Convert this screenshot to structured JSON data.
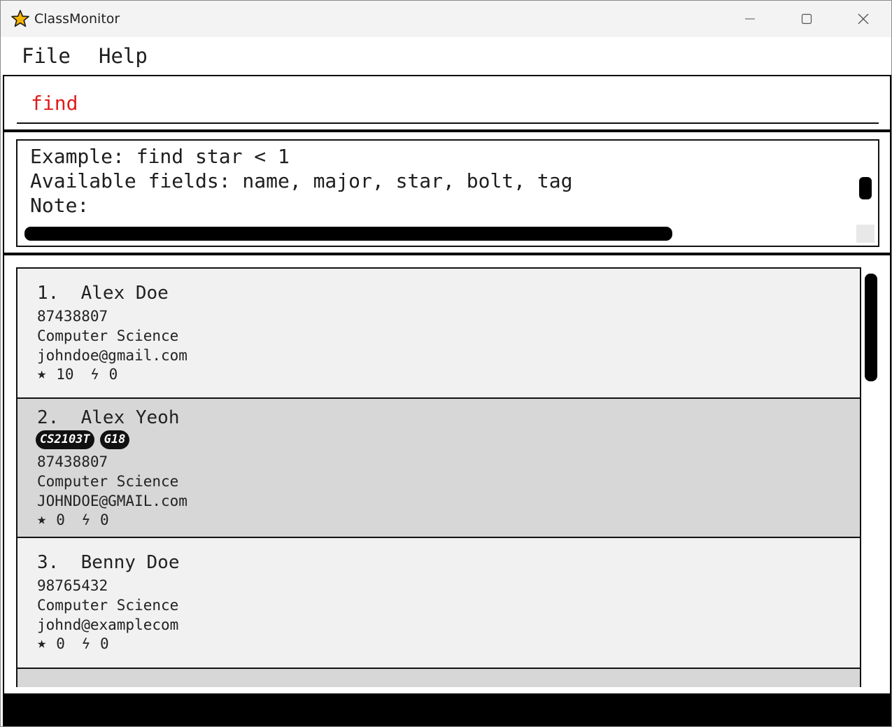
{
  "window": {
    "title": "ClassMonitor",
    "app_icon": "star-icon",
    "controls": [
      "minimize-icon",
      "maximize-icon",
      "close-icon"
    ]
  },
  "menu": {
    "file": "File",
    "help": "Help"
  },
  "command": {
    "value": "find",
    "color": "#e01b1b"
  },
  "result": {
    "lines": [
      "Example: find star < 1",
      "Available fields: name, major, star, bolt, tag",
      "Note:"
    ]
  },
  "persons": [
    {
      "name": "1.  Alex Doe",
      "tags": [],
      "phone": "87438807",
      "major": "Computer Science",
      "email": "johndoe@gmail.com",
      "stars": "10",
      "bolts": "0"
    },
    {
      "name": "2.  Alex Yeoh",
      "tags": [
        "CS2103T",
        "G18"
      ],
      "phone": "87438807",
      "major": "Computer Science",
      "email": "JOHNDOE@GMAIL.com",
      "stars": "0",
      "bolts": "0"
    },
    {
      "name": "3.  Benny Doe",
      "tags": [],
      "phone": "98765432",
      "major": "Computer Science",
      "email": "johnd@examplecom",
      "stars": "0",
      "bolts": "0"
    }
  ]
}
